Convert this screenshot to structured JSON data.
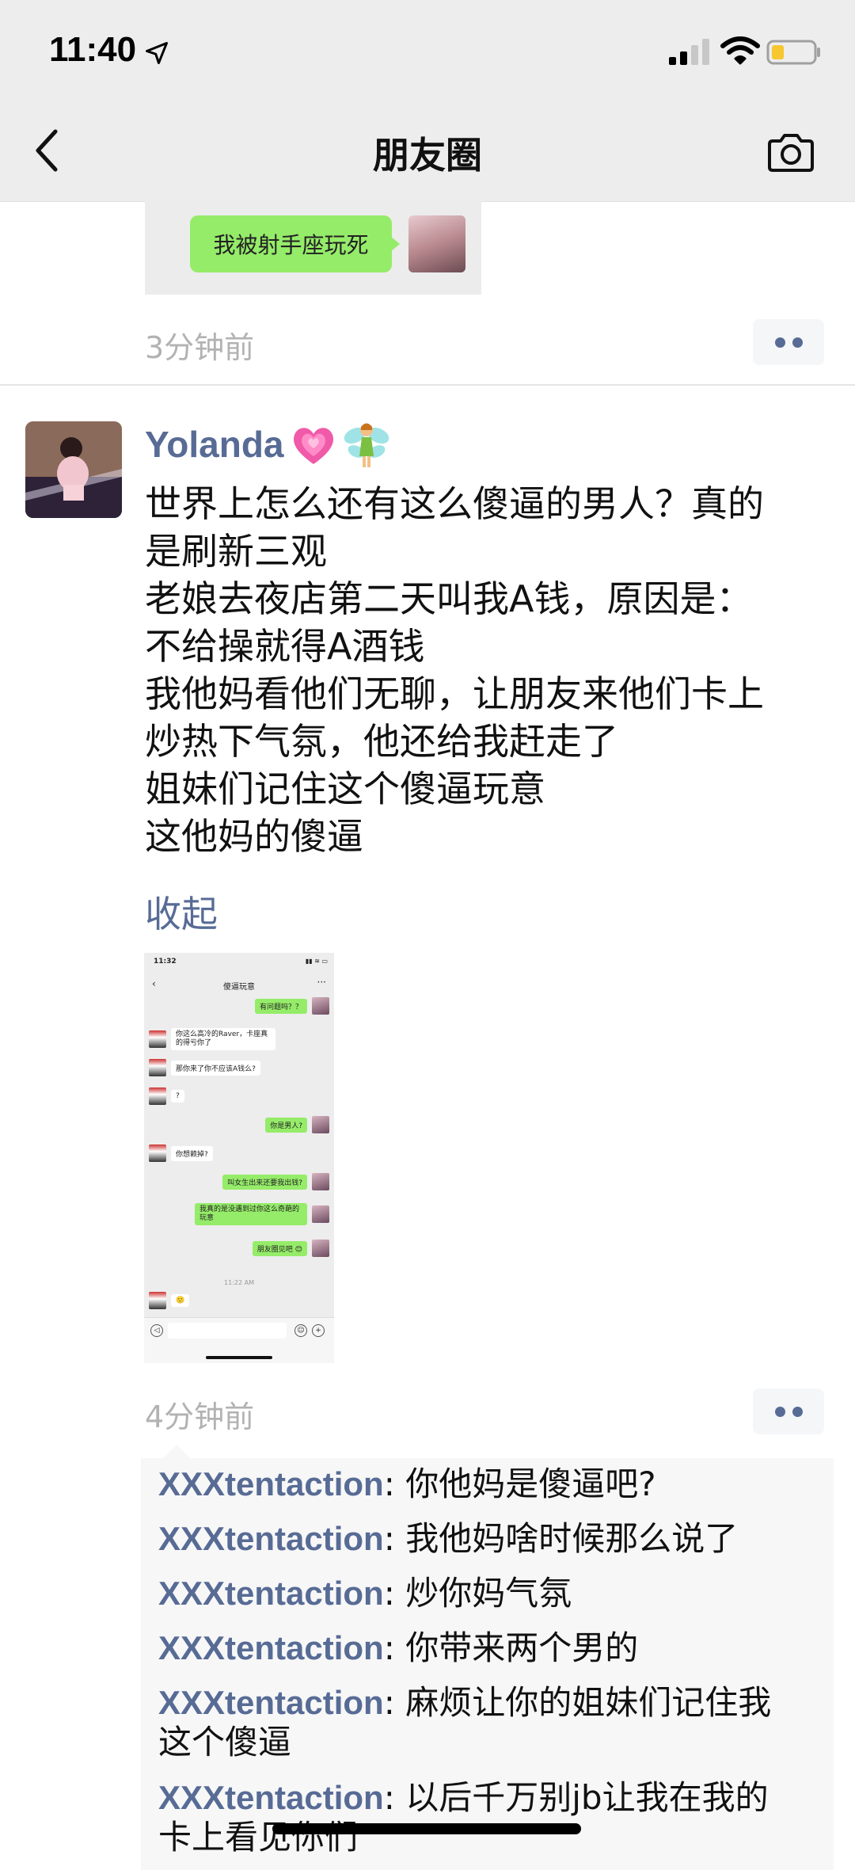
{
  "status_bar": {
    "time": "11:40"
  },
  "nav": {
    "title": "朋友圈"
  },
  "previous_post": {
    "image_bubble_text": "我被射手座玩死",
    "time": "3分钟前"
  },
  "post": {
    "author": "Yolanda",
    "author_emojis": [
      "growing-heart",
      "fairy"
    ],
    "lines": [
      "世界上怎么还有这么傻逼的男人？真的",
      "是刷新三观",
      "老娘去夜店第二天叫我A钱，原因是：",
      "不给操就得A酒钱",
      "我他妈看他们无聊，让朋友来他们卡上",
      "炒热下气氛，他还给我赶走了",
      "姐妹们记住这个傻逼玩意",
      "这他妈的傻逼"
    ],
    "collapse_label": "收起",
    "time": "4分钟前",
    "screenshot": {
      "status_time": "11:32",
      "title": "傻逼玩意",
      "messages": [
        {
          "side": "right",
          "text": "有问题吗？？"
        },
        {
          "side": "left",
          "text": "你这么高冷的Raver，卡座真的得亏你了"
        },
        {
          "side": "left",
          "text": "那你来了你不应该A钱么?"
        },
        {
          "side": "left",
          "text": "?"
        },
        {
          "side": "right",
          "text": "你是男人?"
        },
        {
          "side": "left",
          "text": "你想赖掉?"
        },
        {
          "side": "right",
          "text": "叫女生出来还要我出钱?"
        },
        {
          "side": "right",
          "text": "我真的是没遇到过你这么奇葩的玩意"
        },
        {
          "side": "right",
          "text": "朋友圈见吧 😊"
        },
        {
          "side": "left",
          "text": "🙂"
        }
      ],
      "timestamp": "11:22 AM"
    }
  },
  "comments": [
    {
      "name": "XXXtentaction",
      "sep": ": ",
      "text": "你他妈是傻逼吧?"
    },
    {
      "name": "XXXtentaction",
      "sep": ": ",
      "text": "我他妈啥时候那么说了"
    },
    {
      "name": "XXXtentaction",
      "sep": ": ",
      "text": "炒你妈气氛"
    },
    {
      "name": "XXXtentaction",
      "sep": ": ",
      "text": "你带来两个男的"
    },
    {
      "name": "XXXtentaction",
      "sep": ": ",
      "text": "麻烦让你的姐妹们记住我",
      "text2": "这个傻逼"
    },
    {
      "name": "XXXtentaction",
      "sep": ": ",
      "text": "以后千万别jb让我在我的",
      "text2": "卡上看见你们"
    }
  ],
  "colors": {
    "link": "#576b95",
    "bubble_green": "#95ec69",
    "timestamp_gray": "#b2b2b2"
  }
}
